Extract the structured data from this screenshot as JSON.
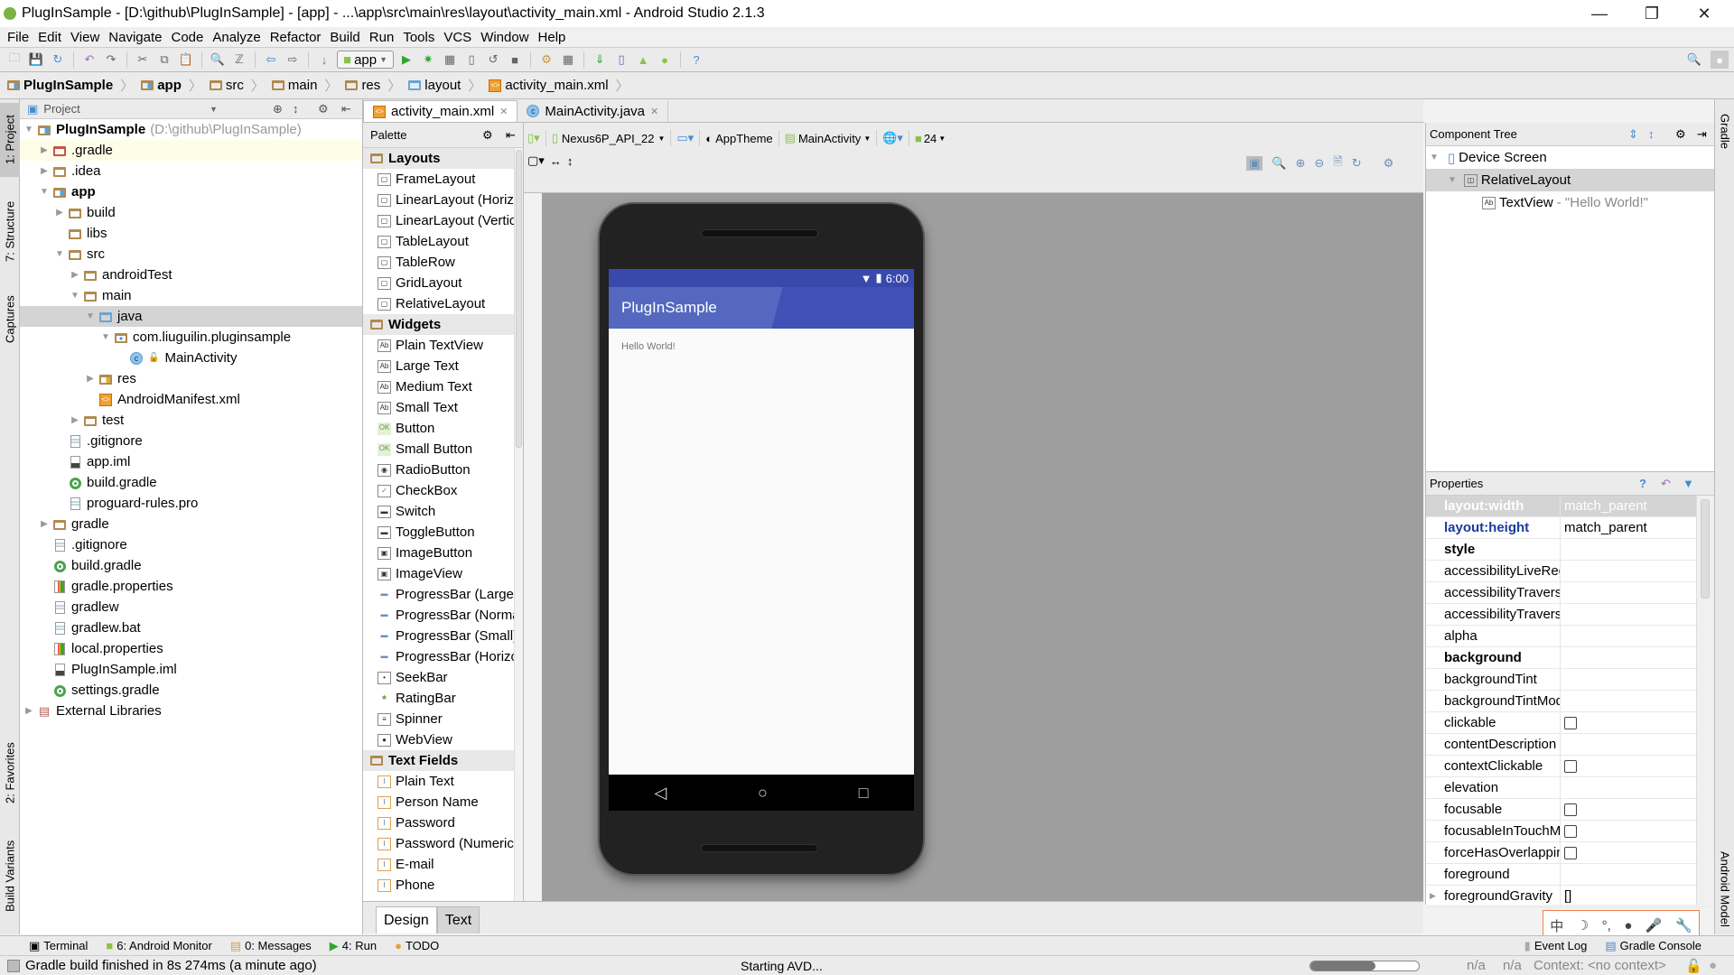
{
  "window": {
    "title": "PlugInSample - [D:\\github\\PlugInSample] - [app] - ...\\app\\src\\main\\res\\layout\\activity_main.xml - Android Studio 2.1.3",
    "controls": [
      "minimize",
      "restore",
      "close"
    ]
  },
  "menu": [
    {
      "label": "File"
    },
    {
      "label": "Edit"
    },
    {
      "label": "View"
    },
    {
      "label": "Navigate"
    },
    {
      "label": "Code"
    },
    {
      "label": "Analyze"
    },
    {
      "label": "Refactor"
    },
    {
      "label": "Build"
    },
    {
      "label": "Run"
    },
    {
      "label": "Tools"
    },
    {
      "label": "VCS"
    },
    {
      "label": "Window"
    },
    {
      "label": "Help"
    }
  ],
  "toolbar": {
    "run_config": "app",
    "icons": [
      "open-folder",
      "save",
      "sync",
      "undo",
      "redo",
      "cut",
      "copy",
      "paste",
      "find",
      "replace",
      "back",
      "forward",
      "make",
      "run",
      "debug",
      "attach",
      "device",
      "apply",
      "stop",
      "project-structure",
      "sdk-manager",
      "sync-gradle",
      "avd-manager",
      "android-device-monitor",
      "help"
    ]
  },
  "breadcrumb": [
    {
      "label": "PlugInSample",
      "bold": true
    },
    {
      "label": "app",
      "bold": true
    },
    {
      "label": "src"
    },
    {
      "label": "main"
    },
    {
      "label": "res"
    },
    {
      "label": "layout"
    },
    {
      "label": "activity_main.xml"
    }
  ],
  "left_strip": {
    "tabs": [
      "1: Project",
      "7: Structure",
      "Captures",
      "2: Favorites",
      "Build Variants"
    ]
  },
  "project": {
    "view_label": "Project",
    "tree": [
      {
        "label": "PlugInSample",
        "suffix": "(D:\\github\\PlugInSample)",
        "depth": 0,
        "arrow": "down",
        "icon": "module",
        "bold": true
      },
      {
        "label": ".gradle",
        "depth": 1,
        "arrow": "right",
        "icon": "folder-red"
      },
      {
        "label": ".idea",
        "depth": 1,
        "arrow": "right",
        "icon": "folder"
      },
      {
        "label": "app",
        "depth": 1,
        "arrow": "down",
        "icon": "module-app",
        "bold": true
      },
      {
        "label": "build",
        "depth": 2,
        "arrow": "right",
        "icon": "folder"
      },
      {
        "label": "libs",
        "depth": 2,
        "arrow": "",
        "icon": "folder"
      },
      {
        "label": "src",
        "depth": 2,
        "arrow": "down",
        "icon": "folder"
      },
      {
        "label": "androidTest",
        "depth": 3,
        "arrow": "right",
        "icon": "folder"
      },
      {
        "label": "main",
        "depth": 3,
        "arrow": "down",
        "icon": "folder"
      },
      {
        "label": "java",
        "depth": 4,
        "arrow": "down",
        "icon": "folder-blue",
        "selected": true
      },
      {
        "label": "com.liuguilin.pluginsample",
        "depth": 5,
        "arrow": "down",
        "icon": "package"
      },
      {
        "label": "MainActivity",
        "depth": 6,
        "arrow": "",
        "icon": "class"
      },
      {
        "label": "res",
        "depth": 4,
        "arrow": "right",
        "icon": "folder-res"
      },
      {
        "label": "AndroidManifest.xml",
        "depth": 4,
        "arrow": "",
        "icon": "xml"
      },
      {
        "label": "test",
        "depth": 3,
        "arrow": "right",
        "icon": "folder"
      },
      {
        "label": ".gitignore",
        "depth": 2,
        "arrow": "",
        "icon": "file"
      },
      {
        "label": "app.iml",
        "depth": 2,
        "arrow": "",
        "icon": "iml"
      },
      {
        "label": "build.gradle",
        "depth": 2,
        "arrow": "",
        "icon": "gradle"
      },
      {
        "label": "proguard-rules.pro",
        "depth": 2,
        "arrow": "",
        "icon": "file"
      },
      {
        "label": "gradle",
        "depth": 1,
        "arrow": "right",
        "icon": "folder"
      },
      {
        "label": ".gitignore",
        "depth": 1,
        "arrow": "",
        "icon": "file"
      },
      {
        "label": "build.gradle",
        "depth": 1,
        "arrow": "",
        "icon": "gradle"
      },
      {
        "label": "gradle.properties",
        "depth": 1,
        "arrow": "",
        "icon": "props"
      },
      {
        "label": "gradlew",
        "depth": 1,
        "arrow": "",
        "icon": "file"
      },
      {
        "label": "gradlew.bat",
        "depth": 1,
        "arrow": "",
        "icon": "file"
      },
      {
        "label": "local.properties",
        "depth": 1,
        "arrow": "",
        "icon": "props"
      },
      {
        "label": "PlugInSample.iml",
        "depth": 1,
        "arrow": "",
        "icon": "iml"
      },
      {
        "label": "settings.gradle",
        "depth": 1,
        "arrow": "",
        "icon": "gradle"
      },
      {
        "label": "External Libraries",
        "depth": 0,
        "arrow": "right",
        "icon": "libraries"
      }
    ]
  },
  "editor_tabs": [
    {
      "label": "activity_main.xml",
      "active": true
    },
    {
      "label": "MainActivity.java",
      "active": false
    }
  ],
  "palette": {
    "title": "Palette",
    "groups": [
      {
        "name": "Layouts",
        "items": [
          "FrameLayout",
          "LinearLayout (Horizontal)",
          "LinearLayout (Vertical)",
          "TableLayout",
          "TableRow",
          "GridLayout",
          "RelativeLayout"
        ]
      },
      {
        "name": "Widgets",
        "items": [
          "Plain TextView",
          "Large Text",
          "Medium Text",
          "Small Text",
          "Button",
          "Small Button",
          "RadioButton",
          "CheckBox",
          "Switch",
          "ToggleButton",
          "ImageButton",
          "ImageView",
          "ProgressBar (Large)",
          "ProgressBar (Normal)",
          "ProgressBar (Small)",
          "ProgressBar (Horizontal)",
          "SeekBar",
          "RatingBar",
          "Spinner",
          "WebView"
        ]
      },
      {
        "name": "Text Fields",
        "items": [
          "Plain Text",
          "Person Name",
          "Password",
          "Password (Numeric)",
          "E-mail",
          "Phone"
        ]
      }
    ]
  },
  "design_toolbar": {
    "device": "Nexus6P_API_22",
    "theme": "AppTheme",
    "activity": "MainActivity",
    "api_level": "24"
  },
  "preview": {
    "status_time": "6:00",
    "app_title": "PlugInSample",
    "hello_text": "Hello World!",
    "primary_color": "#3f51b5",
    "primary_dark_color": "#303f9f"
  },
  "bottom_editor_tabs": [
    {
      "label": "Design",
      "active": true
    },
    {
      "label": "Text",
      "active": false
    }
  ],
  "component_tree": {
    "title": "Component Tree",
    "nodes": [
      {
        "label": "Device Screen",
        "depth": 0
      },
      {
        "label": "RelativeLayout",
        "depth": 1,
        "selected": true
      },
      {
        "label": "TextView",
        "suffix": " - \"Hello World!\"",
        "depth": 2
      }
    ]
  },
  "properties": {
    "title": "Properties",
    "rows": [
      {
        "name": "layout:width",
        "value": "match_parent",
        "style": "header"
      },
      {
        "name": "layout:height",
        "value": "match_parent",
        "style": "blue"
      },
      {
        "name": "style",
        "value": "",
        "style": "bold"
      },
      {
        "name": "accessibilityLiveRegion",
        "value": ""
      },
      {
        "name": "accessibilityTraversalAfter",
        "value": ""
      },
      {
        "name": "accessibilityTraversalBefore",
        "value": ""
      },
      {
        "name": "alpha",
        "value": ""
      },
      {
        "name": "background",
        "value": "",
        "style": "bold"
      },
      {
        "name": "backgroundTint",
        "value": ""
      },
      {
        "name": "backgroundTintMode",
        "value": ""
      },
      {
        "name": "clickable",
        "value": "",
        "checkbox": true
      },
      {
        "name": "contentDescription",
        "value": ""
      },
      {
        "name": "contextClickable",
        "value": "",
        "checkbox": true
      },
      {
        "name": "elevation",
        "value": ""
      },
      {
        "name": "focusable",
        "value": "",
        "checkbox": true
      },
      {
        "name": "focusableInTouchMode",
        "value": "",
        "checkbox": true
      },
      {
        "name": "forceHasOverlappingRendering",
        "value": "",
        "checkbox": true
      },
      {
        "name": "foreground",
        "value": ""
      },
      {
        "name": "foregroundGravity",
        "value": "[]",
        "expandable": true
      }
    ]
  },
  "right_strip": {
    "tabs": [
      "Gradle",
      "Android Model"
    ]
  },
  "tool_windows": {
    "left": [
      {
        "label": "Terminal"
      },
      {
        "label": "6: Android Monitor"
      },
      {
        "label": "0: Messages"
      },
      {
        "label": "4: Run"
      },
      {
        "label": "TODO"
      }
    ],
    "right": [
      {
        "label": "Event Log"
      },
      {
        "label": "Gradle Console"
      }
    ]
  },
  "ime_bar": [
    "中",
    "moon",
    "punct",
    "user",
    "mic",
    "wrench"
  ],
  "status": {
    "message": "Gradle build finished in 8s 274ms (a minute ago)",
    "progress_label": "Starting AVD...",
    "progress_fraction": 0.6,
    "line_col": "n/a",
    "encoding": "n/a",
    "context": "Context: <no context>"
  }
}
